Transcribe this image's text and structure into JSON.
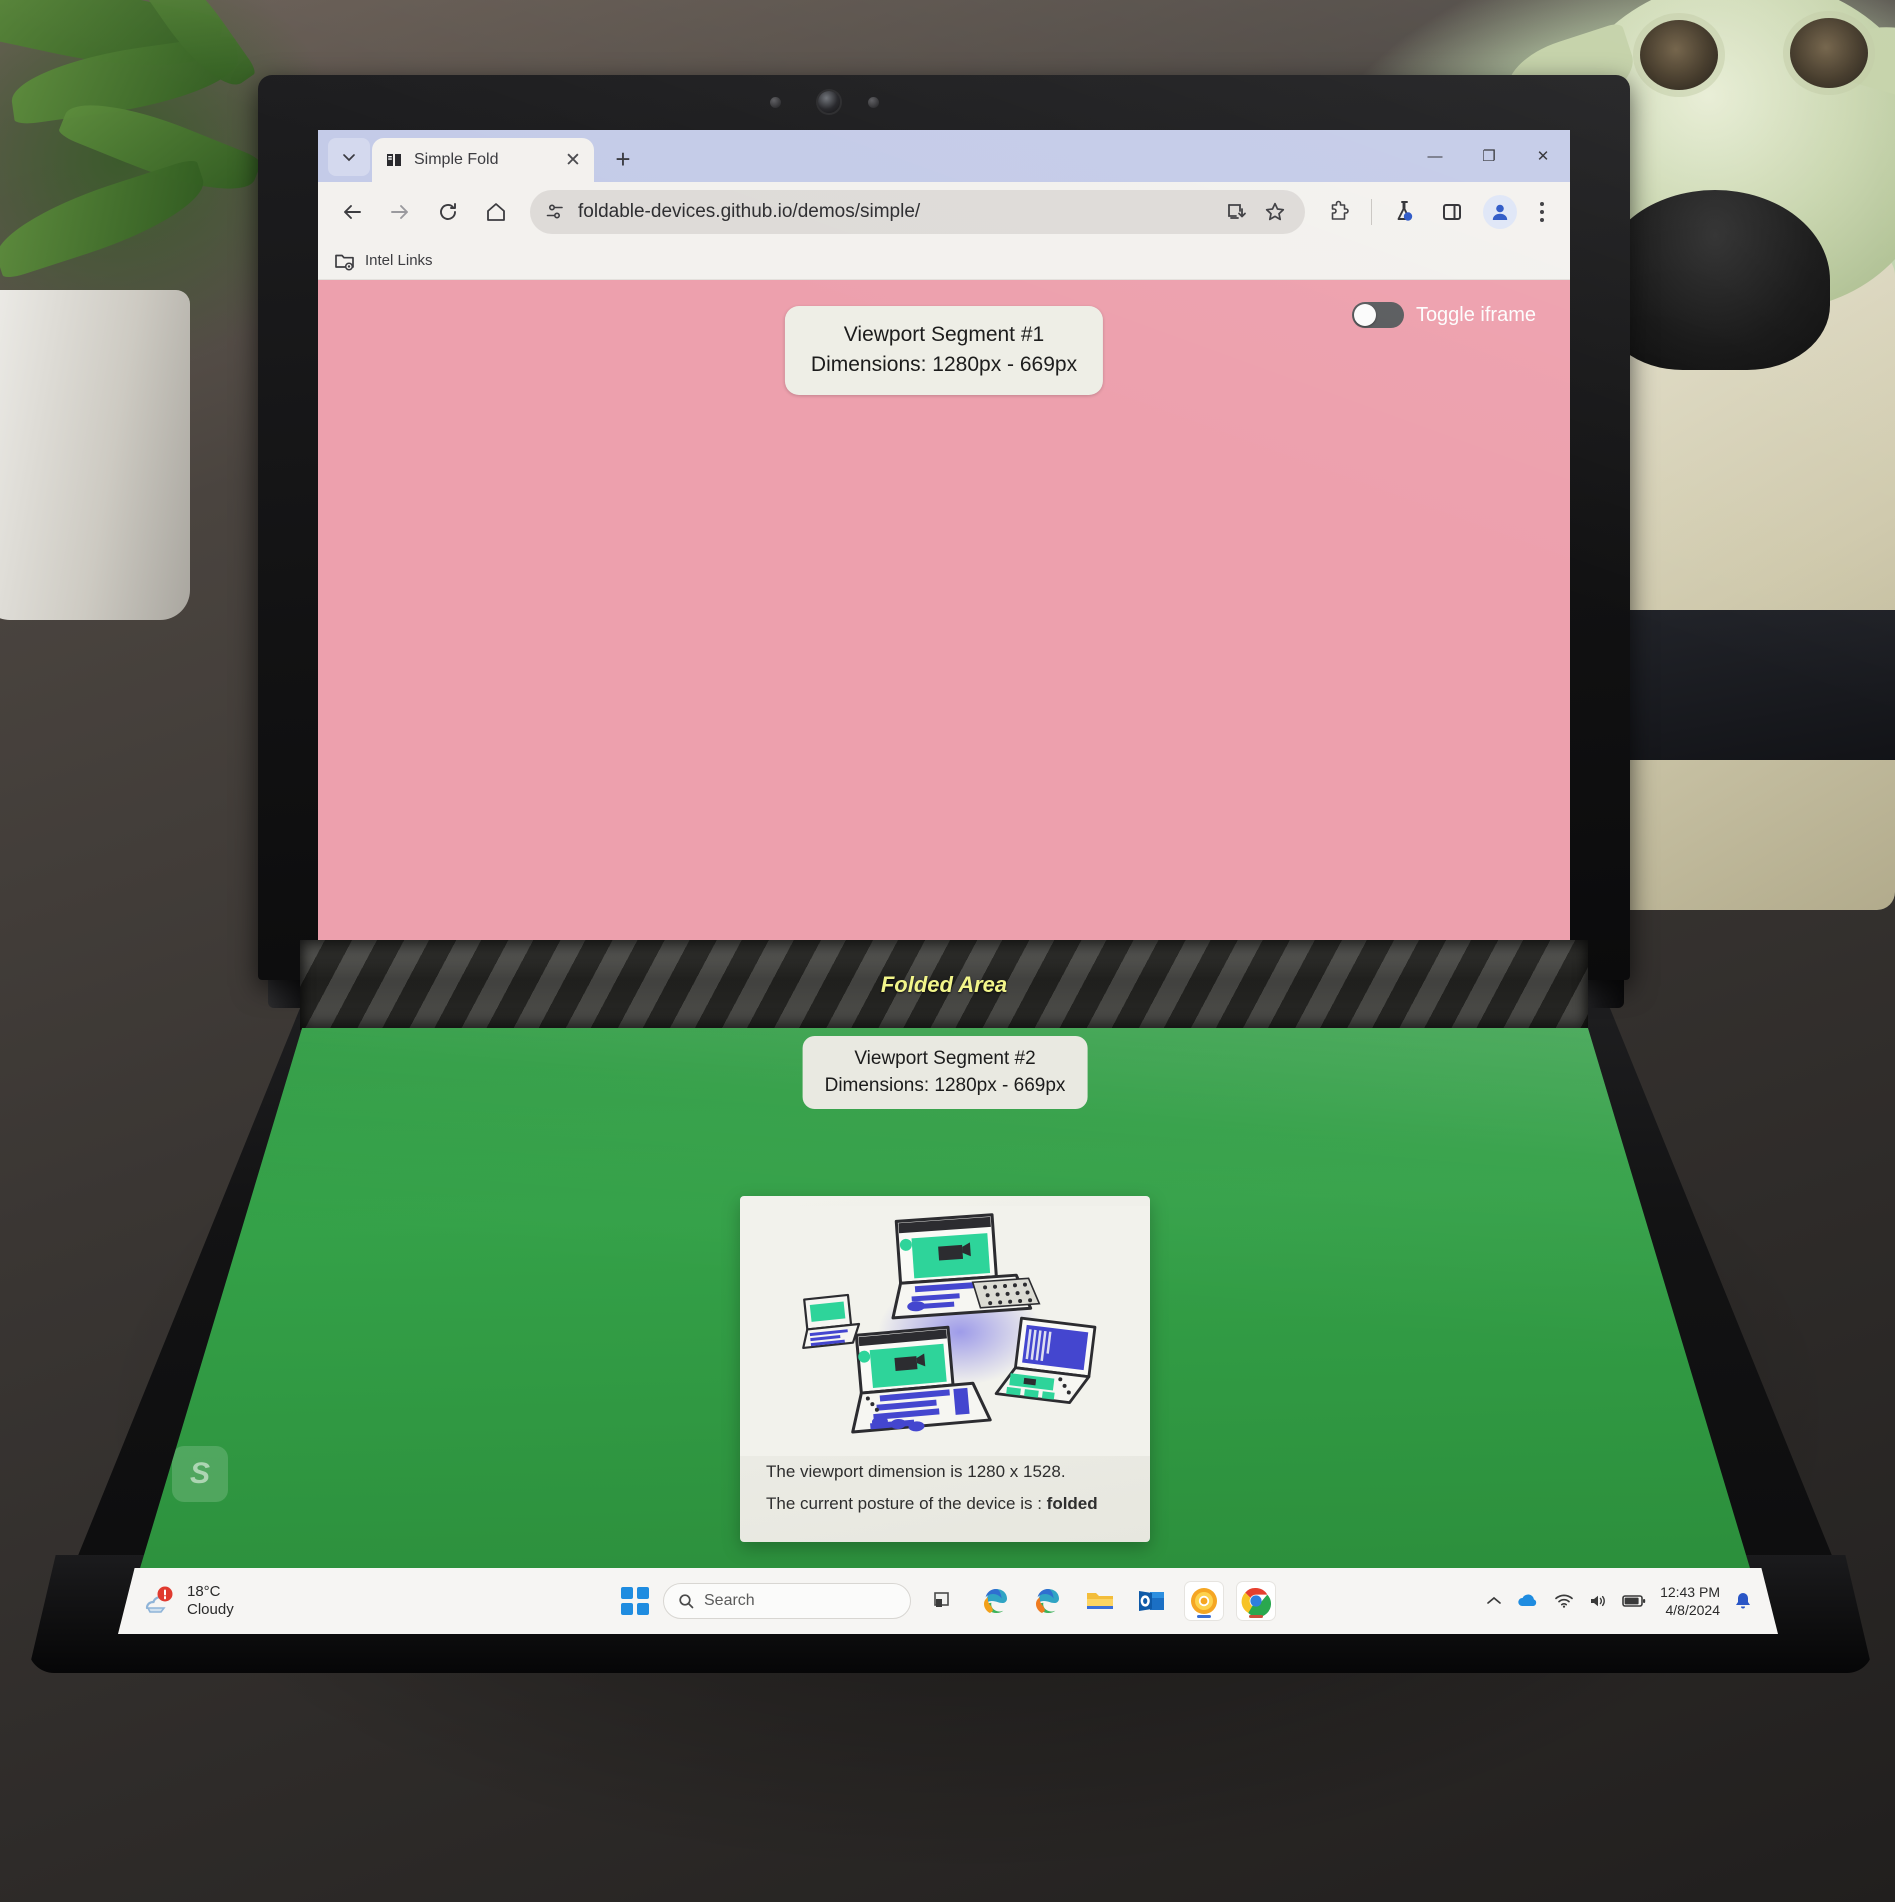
{
  "browser": {
    "tab": {
      "title": "Simple Fold",
      "favicon": "book-open-icon",
      "close": "✕"
    },
    "newtab_label": "+",
    "tabstrip_caret": "chevron-down-icon",
    "window_controls": {
      "minimize": "—",
      "maximize": "❐",
      "close": "✕"
    },
    "toolbar": {
      "back": "back-arrow-icon",
      "forward": "forward-arrow-icon",
      "reload": "reload-icon",
      "home": "home-icon",
      "site_info": "tune-icon",
      "url": "foldable-devices.github.io/demos/simple/",
      "install": "install-app-icon",
      "bookmark": "star-icon",
      "extensions": "puzzle-piece-icon",
      "labs": "flask-icon",
      "side_panel": "side-panel-icon",
      "profile": "profile-avatar-icon",
      "menu": "three-dot-menu-icon"
    },
    "bookmarks": [
      {
        "label": "Intel Links",
        "icon": "managed-folder-icon"
      }
    ]
  },
  "page": {
    "segment1": {
      "title": "Viewport Segment #1",
      "dimensions": "Dimensions: 1280px - 669px",
      "background_color": "#eda0ad"
    },
    "fold": {
      "label": "Folded Area",
      "text_color": "#f2f58a"
    },
    "segment2": {
      "title": "Viewport Segment #2",
      "dimensions": "Dimensions: 1280px - 669px",
      "background_color": "#2f9c43"
    },
    "toggle": {
      "label": "Toggle iframe",
      "state": "off"
    },
    "card": {
      "illustration": "foldable-devices-isometric-illustration",
      "viewport_line": "The viewport dimension is 1280 x 1528.",
      "posture_prefix": "The current posture of the device is : ",
      "posture_value": "folded"
    }
  },
  "taskbar": {
    "weather": {
      "temperature": "18°C",
      "condition": "Cloudy",
      "icon": "cloud-sun-icon",
      "badge": "1"
    },
    "start": "windows-start-icon",
    "search": {
      "placeholder": "Search",
      "icon": "search-icon"
    },
    "pinned": [
      {
        "name": "task-view",
        "icon": "task-view-icon"
      },
      {
        "name": "edge",
        "icon": "edge-icon"
      },
      {
        "name": "edge-dev",
        "icon": "edge-dev-icon"
      },
      {
        "name": "file-explorer",
        "icon": "folder-icon"
      },
      {
        "name": "outlook",
        "icon": "outlook-icon"
      },
      {
        "name": "chrome-canary",
        "icon": "chrome-canary-icon"
      },
      {
        "name": "chrome",
        "icon": "chrome-icon"
      }
    ],
    "tray": {
      "overflow": "chevron-up-icon",
      "onedrive": "onedrive-cloud-icon",
      "wifi": "wifi-icon",
      "volume": "speaker-icon",
      "battery": "battery-icon",
      "time": "12:43 PM",
      "date": "4/8/2024",
      "notifications": "bell-icon"
    }
  }
}
